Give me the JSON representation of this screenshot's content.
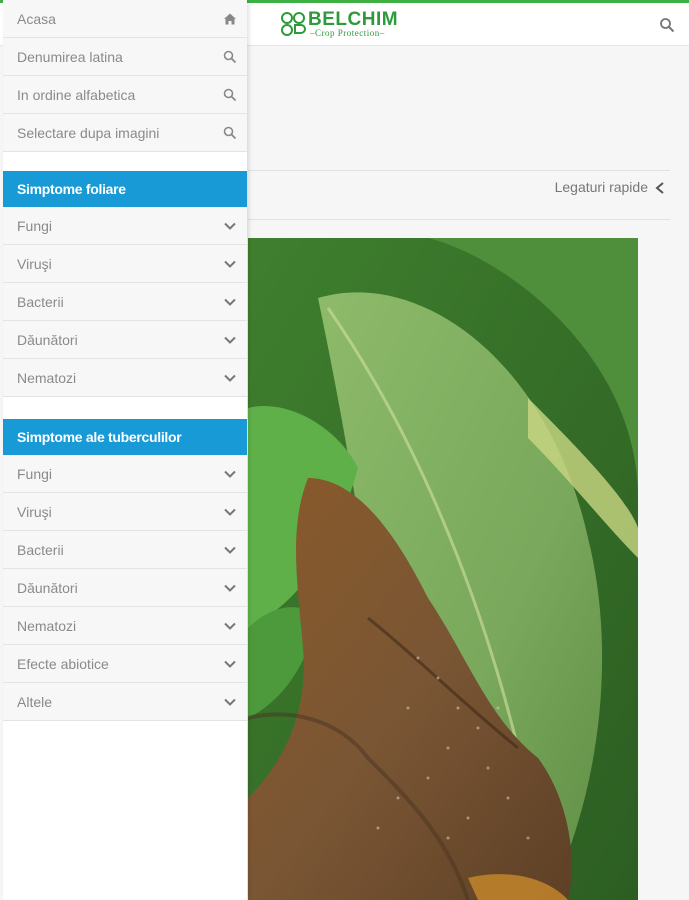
{
  "header": {
    "logo_text": "BELCHIM",
    "logo_subtext": "Crop Protection",
    "search_icon": "search-icon"
  },
  "quicklinks": {
    "label": "Legaturi rapide",
    "icon": "chevron-left-icon"
  },
  "nav": {
    "top_items": [
      {
        "label": "Acasa",
        "icon": "home-icon"
      },
      {
        "label": "Denumirea latina",
        "icon": "search-icon"
      },
      {
        "label": "In ordine alfabetica",
        "icon": "search-icon"
      },
      {
        "label": "Selectare dupa imagini",
        "icon": "search-icon"
      }
    ],
    "foliar": {
      "title": "Simptome foliare",
      "items": [
        {
          "label": "Fungi",
          "icon": "chevron-down-icon"
        },
        {
          "label": "Viruşi",
          "icon": "chevron-down-icon"
        },
        {
          "label": "Bacterii",
          "icon": "chevron-down-icon"
        },
        {
          "label": "Dăunători",
          "icon": "chevron-down-icon"
        },
        {
          "label": "Nematozi",
          "icon": "chevron-down-icon"
        }
      ]
    },
    "tubers": {
      "title": "Simptome ale tuberculilor",
      "items": [
        {
          "label": "Fungi",
          "icon": "chevron-down-icon"
        },
        {
          "label": "Viruşi",
          "icon": "chevron-down-icon"
        },
        {
          "label": "Bacterii",
          "icon": "chevron-down-icon"
        },
        {
          "label": "Dăunători",
          "icon": "chevron-down-icon"
        },
        {
          "label": "Nematozi",
          "icon": "chevron-down-icon"
        },
        {
          "label": "Efecte abiotice",
          "icon": "chevron-down-icon"
        },
        {
          "label": "Altele",
          "icon": "chevron-down-icon"
        }
      ]
    }
  },
  "colors": {
    "accent_green": "#3db043",
    "section_blue": "#189ad6",
    "logo_green": "#2e9a3c"
  }
}
